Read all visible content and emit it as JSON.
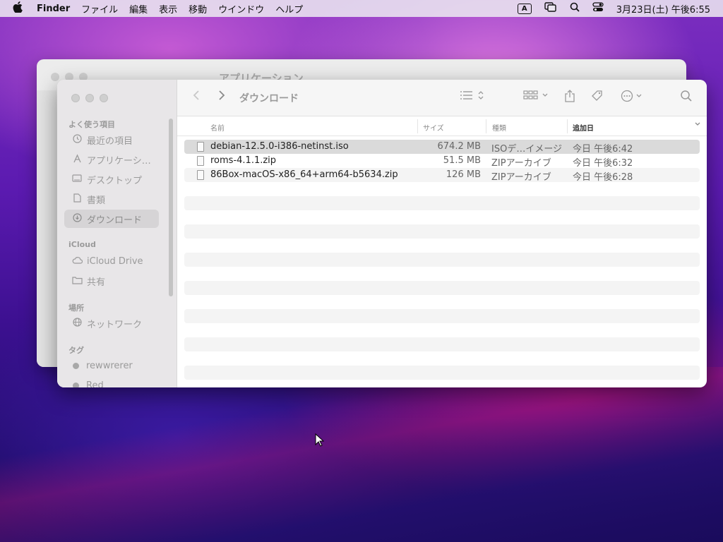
{
  "menubar": {
    "apple_icon": "apple-logo-icon",
    "app_name": "Finder",
    "menus": [
      "ファイル",
      "編集",
      "表示",
      "移動",
      "ウインドウ",
      "ヘルプ"
    ],
    "input_mode": "A",
    "datetime": "3月23日(土) 午後6:55"
  },
  "back_window": {
    "title": "アプリケーション"
  },
  "window": {
    "title": "ダウンロード",
    "sidebar": {
      "favorites_label": "よく使う項目",
      "favorites": [
        "最近の項目",
        "アプリケーシ…",
        "デスクトップ",
        "書類",
        "ダウンロード"
      ],
      "icloud_label": "iCloud",
      "icloud": [
        "iCloud Drive",
        "共有"
      ],
      "locations_label": "場所",
      "locations": [
        "ネットワーク"
      ],
      "tags_label": "タグ",
      "tags": [
        "rewwrerer",
        "Red"
      ]
    },
    "columns": {
      "name": "名前",
      "size": "サイズ",
      "kind": "種類",
      "date_added": "追加日"
    },
    "files": [
      {
        "name": "debian-12.5.0-i386-netinst.iso",
        "size": "674.2 MB",
        "kind": "ISOデ…イメージ",
        "date": "今日 午後6:42"
      },
      {
        "name": "roms-4.1.1.zip",
        "size": "51.5 MB",
        "kind": "ZIPアーカイブ",
        "date": "今日 午後6:32"
      },
      {
        "name": "86Box-macOS-x86_64+arm64-b5634.zip",
        "size": "126 MB",
        "kind": "ZIPアーカイブ",
        "date": "今日 午後6:28"
      }
    ]
  }
}
